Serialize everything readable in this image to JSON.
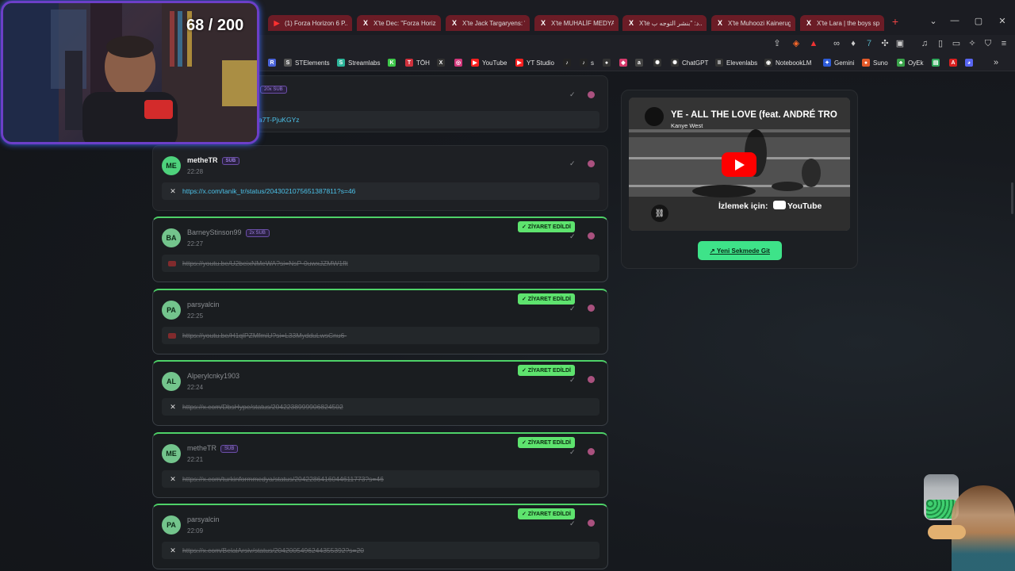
{
  "stream_overlay": {
    "counter": "68 / 200"
  },
  "tabs": [
    {
      "label": "(1) Forza Horizon 6 P...",
      "icon": "youtube-icon",
      "color": "#ff3030",
      "glyph": "▶"
    },
    {
      "label": "X'te Dec: \"Forza Horiz...",
      "icon": "x-icon",
      "color": "#ffffff",
      "glyph": "X"
    },
    {
      "label": "X'te Jack Targaryens: \"...",
      "icon": "x-icon",
      "color": "#ffffff",
      "glyph": "X"
    },
    {
      "label": "X'te MUHALİF MEDYA:...",
      "icon": "x-icon",
      "color": "#ffffff",
      "glyph": "X"
    },
    {
      "label": "X'te د: \"بنشر التوجه ب...",
      "icon": "x-icon",
      "color": "#ffffff",
      "glyph": "X"
    },
    {
      "label": "X'te Muhoozi Kainerug...",
      "icon": "x-icon",
      "color": "#ffffff",
      "glyph": "X"
    },
    {
      "label": "X'te Lara | the boys sp...",
      "icon": "x-icon",
      "color": "#ffffff",
      "glyph": "X"
    }
  ],
  "bookmarks": [
    {
      "label": "",
      "icon": "r-icon",
      "glyph": "R",
      "color": "#4a63d8"
    },
    {
      "label": "STElements",
      "icon": "streamelements-icon",
      "glyph": "S",
      "color": "#555"
    },
    {
      "label": "Streamlabs",
      "icon": "streamlabs-icon",
      "glyph": "S",
      "color": "#2cb59a"
    },
    {
      "label": "",
      "icon": "kick-icon",
      "glyph": "K",
      "color": "#3ec84a"
    },
    {
      "label": "TÖH",
      "icon": "toh-icon",
      "glyph": "T",
      "color": "#d0313c"
    },
    {
      "label": "",
      "icon": "x-icon",
      "glyph": "X",
      "color": "#333"
    },
    {
      "label": "",
      "icon": "instagram-icon",
      "glyph": "◎",
      "color": "#d2367a"
    },
    {
      "label": "YouTube",
      "icon": "youtube-icon",
      "glyph": "▶",
      "color": "#ff2020"
    },
    {
      "label": "YT Studio",
      "icon": "yt-studio-icon",
      "glyph": "▶",
      "color": "#ff2020"
    },
    {
      "label": "",
      "icon": "tiktok-icon",
      "glyph": "♪",
      "color": "#222"
    },
    {
      "label": "s",
      "icon": "tiktok-icon",
      "glyph": "♪",
      "color": "#222"
    },
    {
      "label": "",
      "icon": "github-icon",
      "glyph": "●",
      "color": "#333"
    },
    {
      "label": "",
      "icon": "app-icon",
      "glyph": "◆",
      "color": "#d43a6b"
    },
    {
      "label": "",
      "icon": "amazon-icon",
      "glyph": "a",
      "color": "#444"
    },
    {
      "label": "",
      "icon": "openai-icon",
      "glyph": "✺",
      "color": "#333"
    },
    {
      "label": "ChatGPT",
      "icon": "chatgpt-icon",
      "glyph": "✺",
      "color": "#333"
    },
    {
      "label": "Elevenlabs",
      "icon": "elevenlabs-icon",
      "glyph": "II",
      "color": "#333"
    },
    {
      "label": "NotebookLM",
      "icon": "notebooklm-icon",
      "glyph": "◉",
      "color": "#333"
    },
    {
      "label": "Gemini",
      "icon": "gemini-icon",
      "glyph": "✦",
      "color": "#2d5bd8"
    },
    {
      "label": "Suno",
      "icon": "suno-icon",
      "glyph": "●",
      "color": "#e35a2a"
    },
    {
      "label": "OyEk",
      "icon": "oyek-icon",
      "glyph": "♣",
      "color": "#3aa34a"
    },
    {
      "label": "",
      "icon": "green-app-icon",
      "glyph": "▤",
      "color": "#2fa85a"
    },
    {
      "label": "",
      "icon": "pdf-icon",
      "glyph": "A",
      "color": "#d92020"
    },
    {
      "label": "",
      "icon": "discord-icon",
      "glyph": "◕",
      "color": "#5865f2"
    }
  ],
  "cards": [
    {
      "initials": "",
      "user": "",
      "sub": "20x SUB",
      "time": "",
      "link": "a7T-PjuKGYz",
      "link_icon": "x-icon",
      "visited": false,
      "partial": true
    },
    {
      "initials": "ME",
      "user": "metheTR",
      "sub": "SUB",
      "time": "22:28",
      "link": "https://x.com/tanik_tr/status/2043021075651387811?s=46",
      "link_icon": "x-icon",
      "visited": false
    },
    {
      "initials": "BA",
      "user": "BarneyStinson99",
      "sub": "2x SUB",
      "time": "22:27",
      "link": "https://youtu.be/U2beixNMeWA?si=NsP-0uwxJZMW1flt",
      "link_icon": "youtube-icon",
      "visited": true
    },
    {
      "initials": "PA",
      "user": "parsyalcin",
      "sub": "",
      "time": "22:25",
      "link": "https://youtu.be/H1qlPZMfmiU?si=L33MydduLwsCnu6-",
      "link_icon": "youtube-icon",
      "visited": true
    },
    {
      "initials": "AL",
      "user": "Alperylcnky1903",
      "sub": "",
      "time": "22:24",
      "link": "https://x.com/DbsHype/status/2042238999906824502",
      "link_icon": "x-icon",
      "visited": true
    },
    {
      "initials": "ME",
      "user": "metheTR",
      "sub": "SUB",
      "time": "22:21",
      "link": "https://x.com/turkinformmedya/status/2042286416044611773?s=46",
      "link_icon": "x-icon",
      "visited": true
    },
    {
      "initials": "PA",
      "user": "parsyalcin",
      "sub": "",
      "time": "22:09",
      "link": "https://x.com/BelalArsiv/status/2042005496244355392?s=20",
      "link_icon": "x-icon",
      "visited": true
    }
  ],
  "visited_badge": "✓ ZİYARET EDİLDİ",
  "video": {
    "title": "YE - ALL THE LOVE (feat. ANDRÉ TRO",
    "artist": "Kanye West",
    "watch_on": "İzlemek için:",
    "platform": "YouTube",
    "open_button": "↗ Yeni Sekmede Git"
  }
}
